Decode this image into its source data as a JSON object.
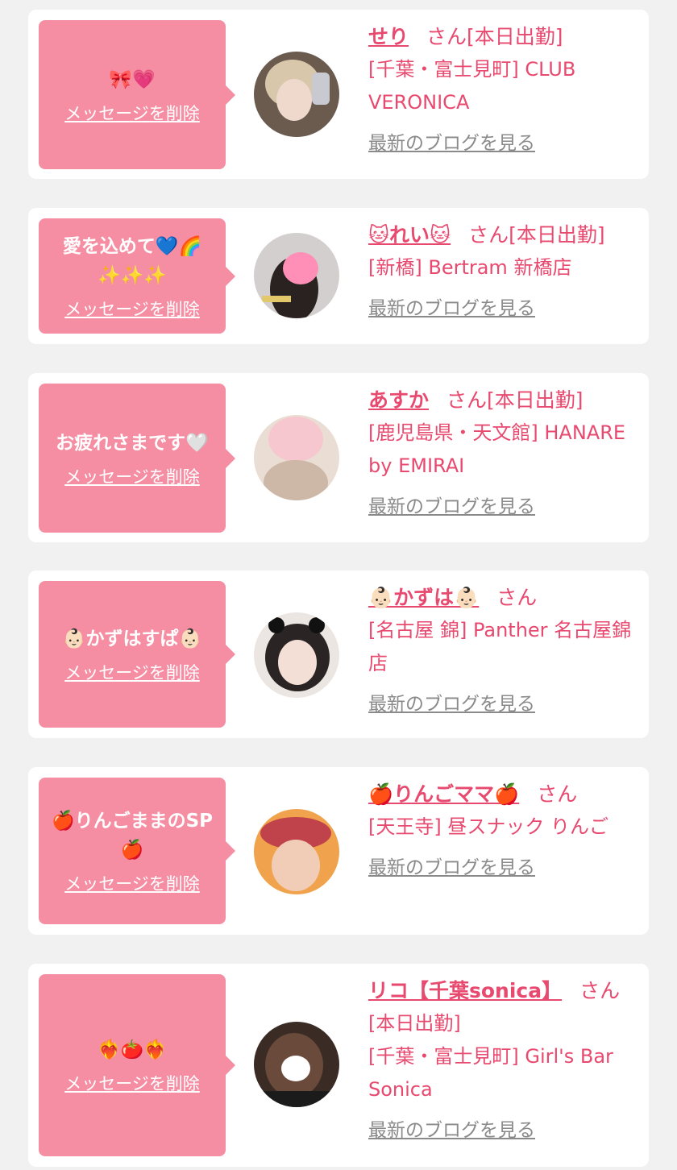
{
  "delete_label": "メッセージを削除",
  "blog_label": "最新のブログを見る",
  "colors": {
    "page_bg": "#f1f1f1",
    "card_bg": "#ffffff",
    "bubble": "#f68ea3",
    "accent": "#e8496f",
    "muted": "#8a8a8a"
  },
  "items": [
    {
      "message": "🎀💗",
      "name": "せり",
      "suffix": "さん[本日出勤]",
      "shop": "[千葉・富士見町] CLUB VERONICA"
    },
    {
      "message": "愛を込めて💙🌈✨✨✨",
      "name": "🐱れい🐱",
      "suffix": "さん[本日出勤]",
      "shop": "[新橋] Bertram 新橋店"
    },
    {
      "message": "お疲れさまです🤍",
      "name": "あすか",
      "suffix": "さん[本日出勤]",
      "shop": "[鹿児島県・天文館] HANARE by EMIRAI"
    },
    {
      "message": "👶🏻かずはすぱ👶🏻",
      "name": "👶🏻かずは👶🏻",
      "suffix": "さん",
      "shop": "[名古屋 錦] Panther 名古屋錦店"
    },
    {
      "message": "🍎りんごままのSP🍎",
      "name": "🍎りんごママ🍎",
      "suffix": "さん",
      "shop": "[天王寺] 昼スナック りんご"
    },
    {
      "message": "❤️‍🔥🍅❤️‍🔥",
      "name": "リコ【千葉sonica】",
      "suffix": "さん",
      "status": "[本日出勤]",
      "shop": "[千葉・富士見町] Girl's Bar Sonica"
    }
  ]
}
